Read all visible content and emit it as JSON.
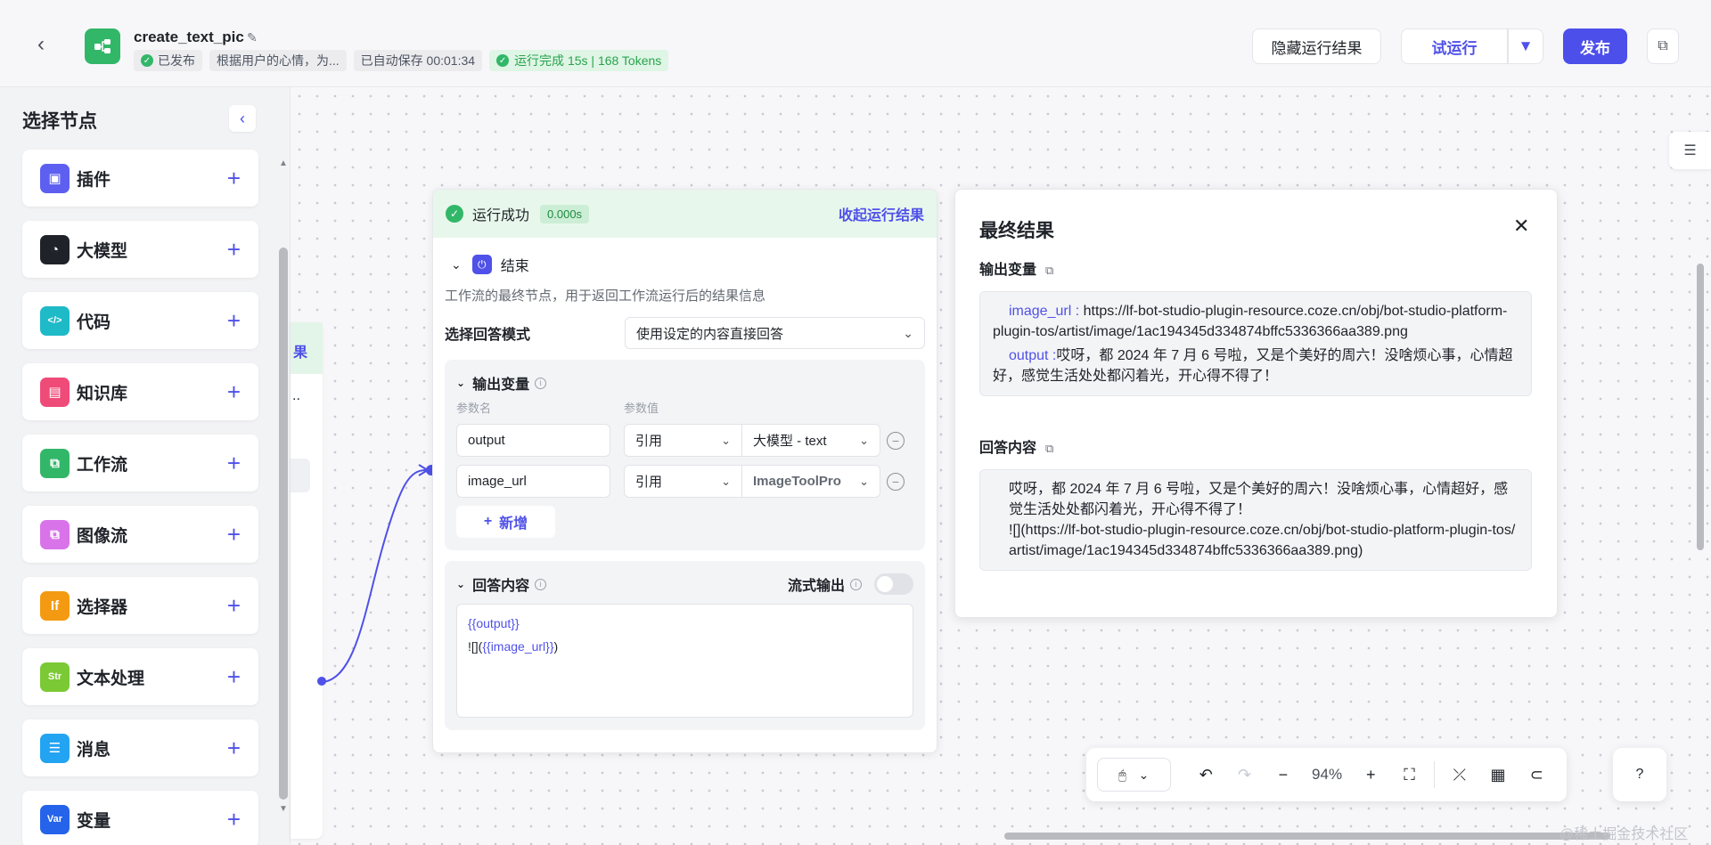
{
  "header": {
    "title": "create_text_pic",
    "status_published": "已发布",
    "description": "根据用户的心情，为...",
    "autosave": "已自动保存 00:01:34",
    "run_status": "运行完成 15s | 168 Tokens",
    "hide_results": "隐藏运行结果",
    "try_run": "试运行",
    "publish": "发布"
  },
  "sidebar": {
    "title": "选择节点",
    "items": [
      {
        "label": "插件",
        "icon": "plugin-icon",
        "color": "#5d5ff0",
        "glyph": "▣"
      },
      {
        "label": "大模型",
        "icon": "llm-icon",
        "color": "#1f2329",
        "glyph": "◔"
      },
      {
        "label": "代码",
        "icon": "code-icon",
        "color": "#1fbac8",
        "glyph": "</>"
      },
      {
        "label": "知识库",
        "icon": "knowledge-icon",
        "color": "#ef4b78",
        "glyph": "▤"
      },
      {
        "label": "工作流",
        "icon": "workflow-icon",
        "color": "#32b769",
        "glyph": "⧉"
      },
      {
        "label": "图像流",
        "icon": "imageflow-icon",
        "color": "#d873ea",
        "glyph": "⧉"
      },
      {
        "label": "选择器",
        "icon": "selector-icon",
        "color": "#f39a12",
        "glyph": "If"
      },
      {
        "label": "文本处理",
        "icon": "text-process-icon",
        "color": "#7bc934",
        "glyph": "Str"
      },
      {
        "label": "消息",
        "icon": "message-icon",
        "color": "#23a4f2",
        "glyph": "☰"
      },
      {
        "label": "变量",
        "icon": "variable-icon",
        "color": "#2563eb",
        "glyph": "Var"
      }
    ]
  },
  "bg_node": {
    "partial_label": "果",
    "dots": ".."
  },
  "end_node": {
    "run_success": "运行成功",
    "run_time": "0.000s",
    "collapse_results": "收起运行结果",
    "title": "结束",
    "description": "工作流的最终节点，用于返回工作流运行后的结果信息",
    "mode_label": "选择回答模式",
    "mode_value": "使用设定的内容直接回答",
    "output_section": "输出变量",
    "col_name": "参数名",
    "col_value": "参数值",
    "vars": [
      {
        "name": "output",
        "ref": "引用",
        "value": "大模型 - text"
      },
      {
        "name": "image_url",
        "ref": "引用",
        "value": "ImageToolPro"
      }
    ],
    "add_label": "新增",
    "answer_section": "回答内容",
    "stream_label": "流式输出",
    "answer_line1": "{{output}}",
    "answer_line2_prefix": "![](",
    "answer_line2_var": "{{image_url}}",
    "answer_line2_suffix": ")"
  },
  "result": {
    "title": "最终结果",
    "output_label": "输出变量",
    "image_url_key": "image_url :",
    "image_url_val": "https://lf-bot-studio-plugin-resource.coze.cn/obj/bot-studio-platform-plugin-tos/artist/image/1ac194345d334874bffc5336366aa389.png",
    "output_key": "output :",
    "output_val": "哎呀，都 2024 年 7 月 6 号啦，又是个美好的周六！没啥烦心事，心情超好，感觉生活处处都闪着光，开心得不得了！",
    "answer_label": "回答内容",
    "answer_text": "哎呀，都 2024 年 7 月 6 号啦，又是个美好的周六！没啥烦心事，心情超好，感觉生活处处都闪着光，开心得不得了！",
    "answer_img": "![](https://lf-bot-studio-plugin-resource.coze.cn/obj/bot-studio-platform-plugin-tos/artist/image/1ac194345d334874bffc5336366aa389.png)"
  },
  "toolbar": {
    "zoom": "94%"
  },
  "watermark": "@稀土掘金技术社区"
}
